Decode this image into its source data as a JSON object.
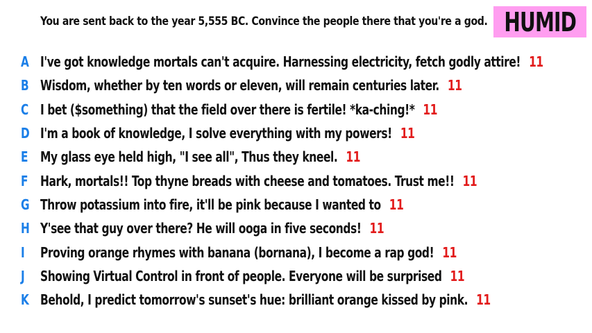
{
  "prompt": "You are sent back to the year 5,555 BC. Convince the people there that you're a god.",
  "badge": {
    "label": "HUMID",
    "color": "#ff9df0"
  },
  "colors": {
    "letter": "#1b7fe8",
    "score": "#e21b1b"
  },
  "answers": [
    {
      "letter": "A",
      "text": "I've got knowledge mortals can't acquire. Harnessing electricity, fetch godly attire!",
      "score": "11"
    },
    {
      "letter": "B",
      "text": "Wisdom, whether by ten words or eleven, will remain centuries later.",
      "score": "11"
    },
    {
      "letter": "C",
      "text": "I bet ($something) that the field over there is fertile! *ka-ching!*",
      "score": "11"
    },
    {
      "letter": "D",
      "text": "I'm a book of knowledge, I solve everything with my powers!",
      "score": "11"
    },
    {
      "letter": "E",
      "text": "My glass eye held high, \"I see all\", Thus they kneel.",
      "score": "11"
    },
    {
      "letter": "F",
      "text": "Hark, mortals!! Top thyne breads with cheese and tomatoes. Trust me!!",
      "score": "11"
    },
    {
      "letter": "G",
      "text": "Throw potassium into fire, it'll be pink because I wanted to",
      "score": "11"
    },
    {
      "letter": "H",
      "text": "Y'see that guy over there? He will ooga in five seconds!",
      "score": "11"
    },
    {
      "letter": "I",
      "text": "Proving orange rhymes with banana (bornana), I become a rap god!",
      "score": "11"
    },
    {
      "letter": "J",
      "text": "Showing Virtual Control in front of people. Everyone will be surprised",
      "score": "11"
    },
    {
      "letter": "K",
      "text": "Behold, I predict tomorrow's sunset's hue: brilliant orange kissed by pink.",
      "score": "11"
    }
  ]
}
